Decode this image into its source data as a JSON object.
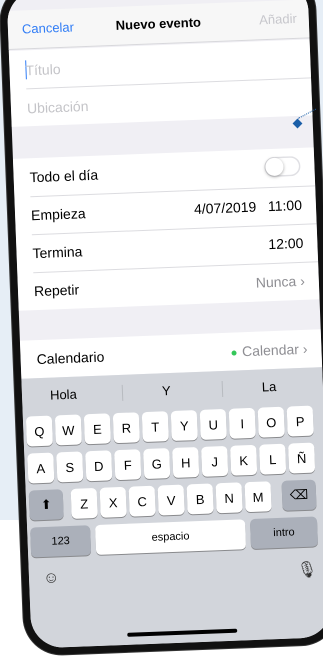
{
  "nav": {
    "cancel_label": "Cancelar",
    "title": "Nuevo evento",
    "add_label": "Añadir"
  },
  "fields": {
    "title_placeholder": "Título",
    "location_placeholder": "Ubicación"
  },
  "rows": {
    "all_day_label": "Todo el día",
    "all_day_enabled": false,
    "starts_label": "Empieza",
    "starts_date": "4/07/2019",
    "starts_time": "11:00",
    "ends_label": "Termina",
    "ends_time": "12:00",
    "repeat_label": "Repetir",
    "repeat_value": "Nunca",
    "calendar_label": "Calendario",
    "calendar_value": "Calendar"
  },
  "keyboard": {
    "suggestions": [
      "Hola",
      "Y",
      "La"
    ],
    "row1": [
      "Q",
      "W",
      "E",
      "R",
      "T",
      "Y",
      "U",
      "I",
      "O",
      "P"
    ],
    "row2": [
      "A",
      "S",
      "D",
      "F",
      "G",
      "H",
      "J",
      "K",
      "L",
      "Ñ"
    ],
    "row3": [
      "Z",
      "X",
      "C",
      "V",
      "B",
      "N",
      "M"
    ],
    "numbers_label": "123",
    "space_label": "espacio",
    "return_label": "intro",
    "shift_icon": "shift-icon",
    "delete_icon": "backspace-icon",
    "emoji_icon": "emoji-icon",
    "mic_icon": "microphone-icon"
  },
  "colors": {
    "accent": "#2f7cf6",
    "disabled": "#c7c7cc",
    "calendar_dot": "#34c759"
  }
}
